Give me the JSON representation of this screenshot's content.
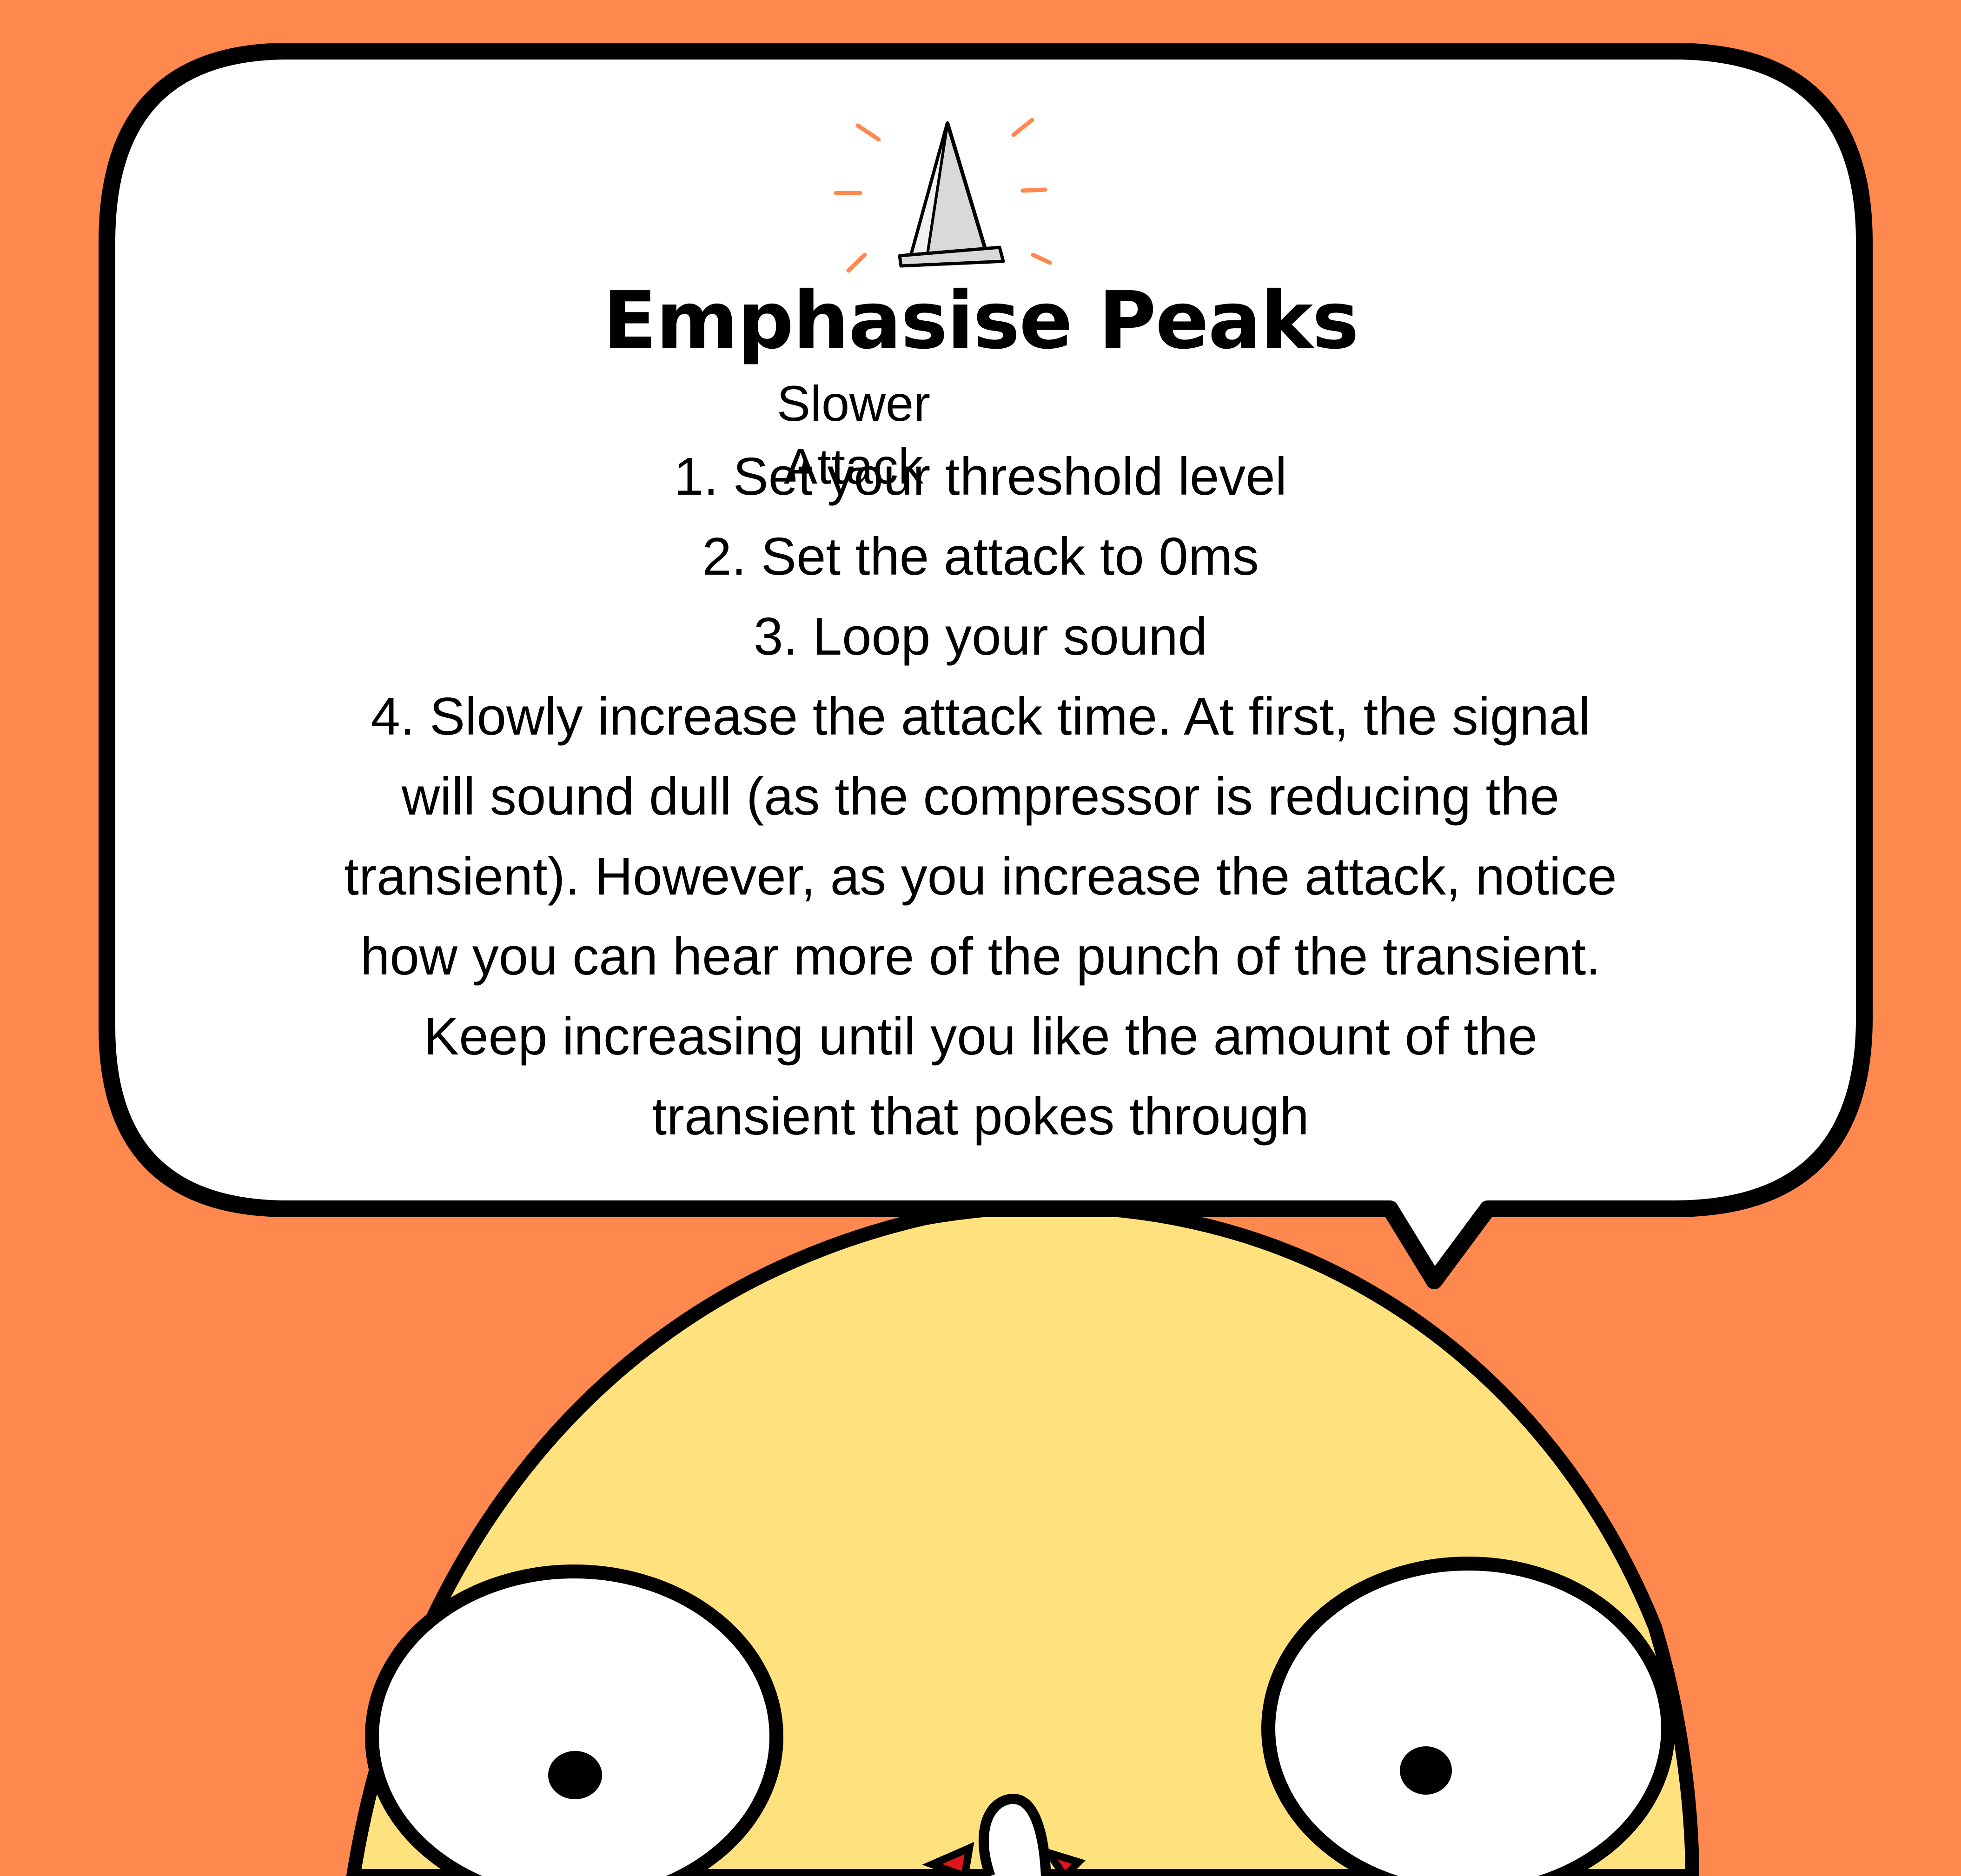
{
  "title": "Emphasise Peaks",
  "subtitle": "Slower Attack",
  "steps": [
    "1. Set your threshold level",
    "2. Set the attack to 0ms",
    "3. Loop your sound",
    "4. Slowly increase the attack time. At first, the signal",
    "will sound dull (as the compressor is reducing the",
    "transient). However, as you increase the attack, notice",
    "how you can hear more of the punch of the transient.",
    "Keep increasing until you like the amount of the",
    "transient that pokes through"
  ],
  "icon": "peak-spike-icon",
  "colors": {
    "background": "#ff884f",
    "bubble": "#ffffff",
    "outline": "#000000",
    "character_body": "#ffe27e",
    "spark": "#ff884f",
    "spike": "#d9d9d9",
    "mouth_accent": "#e0141b"
  }
}
